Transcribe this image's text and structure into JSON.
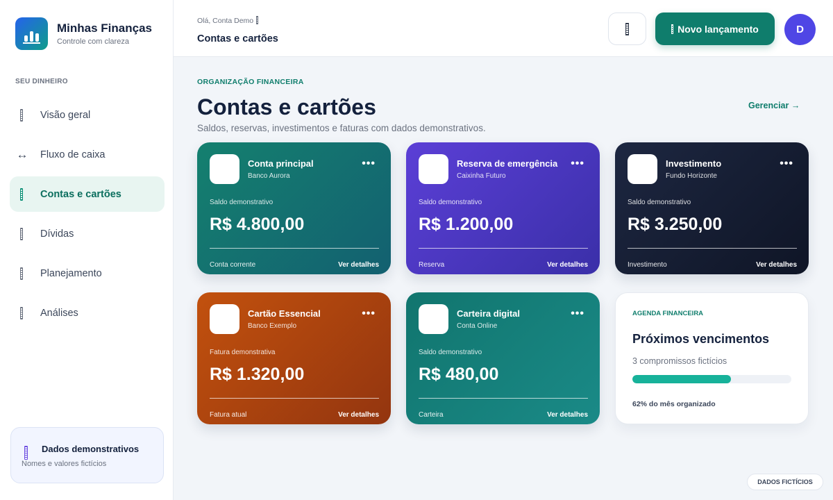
{
  "brand": {
    "title": "Minhas Finanças",
    "subtitle": "Controle com clareza"
  },
  "sidebar": {
    "section_label": "SEU DINHEIRO",
    "items": [
      {
        "label": "Visão geral",
        "icon": "dashboard-icon",
        "active": false
      },
      {
        "label": "Fluxo de caixa",
        "icon": "arrows-icon",
        "active": false
      },
      {
        "label": "Contas e cartões",
        "icon": "wallet-icon",
        "active": true
      },
      {
        "label": "Dívidas",
        "icon": "debt-icon",
        "active": false
      },
      {
        "label": "Planejamento",
        "icon": "planning-icon",
        "active": false
      },
      {
        "label": "Análises",
        "icon": "analytics-icon",
        "active": false
      }
    ],
    "demo_box": {
      "title": "Dados demonstrativos",
      "subtitle": "Nomes e valores fictícios"
    }
  },
  "header": {
    "greeting": "Olá, Conta Demo",
    "title": "Contas e cartões",
    "new_entry_label": "Novo lançamento",
    "avatar_initial": "D"
  },
  "main": {
    "eyebrow": "ORGANIZAÇÃO FINANCEIRA",
    "title": "Contas e cartões",
    "subtitle": "Saldos, reservas, investimentos e faturas com dados demonstrativos.",
    "manage_label": "Gerenciar →"
  },
  "cards": [
    {
      "name": "Conta principal",
      "institution": "Banco Aurora",
      "label": "Saldo demonstrativo",
      "amount": "R$ 4.800,00",
      "type": "Conta corrente",
      "details": "Ver detalhes"
    },
    {
      "name": "Reserva de emergência",
      "institution": "Caixinha Futuro",
      "label": "Saldo demonstrativo",
      "amount": "R$ 1.200,00",
      "type": "Reserva",
      "details": "Ver detalhes"
    },
    {
      "name": "Investimento",
      "institution": "Fundo Horizonte",
      "label": "Saldo demonstrativo",
      "amount": "R$ 3.250,00",
      "type": "Investimento",
      "details": "Ver detalhes"
    },
    {
      "name": "Cartão Essencial",
      "institution": "Banco Exemplo",
      "label": "Fatura demonstrativa",
      "amount": "R$ 1.320,00",
      "type": "Fatura atual",
      "details": "Ver detalhes"
    },
    {
      "name": "Carteira digital",
      "institution": "Conta Online",
      "label": "Saldo demonstrativo",
      "amount": "R$ 480,00",
      "type": "Carteira",
      "details": "Ver detalhes"
    }
  ],
  "agenda": {
    "eyebrow": "AGENDA FINANCEIRA",
    "title": "Próximos vencimentos",
    "count": "3 compromissos fictícios",
    "progress": 0.62,
    "progress_label": "62% do mês organizado"
  },
  "footer_badge": "DADOS FICTÍCIOS",
  "colors": {
    "accent": "#0f7d6c",
    "avatar": "#4f46e5",
    "progress": "#17b29a"
  }
}
